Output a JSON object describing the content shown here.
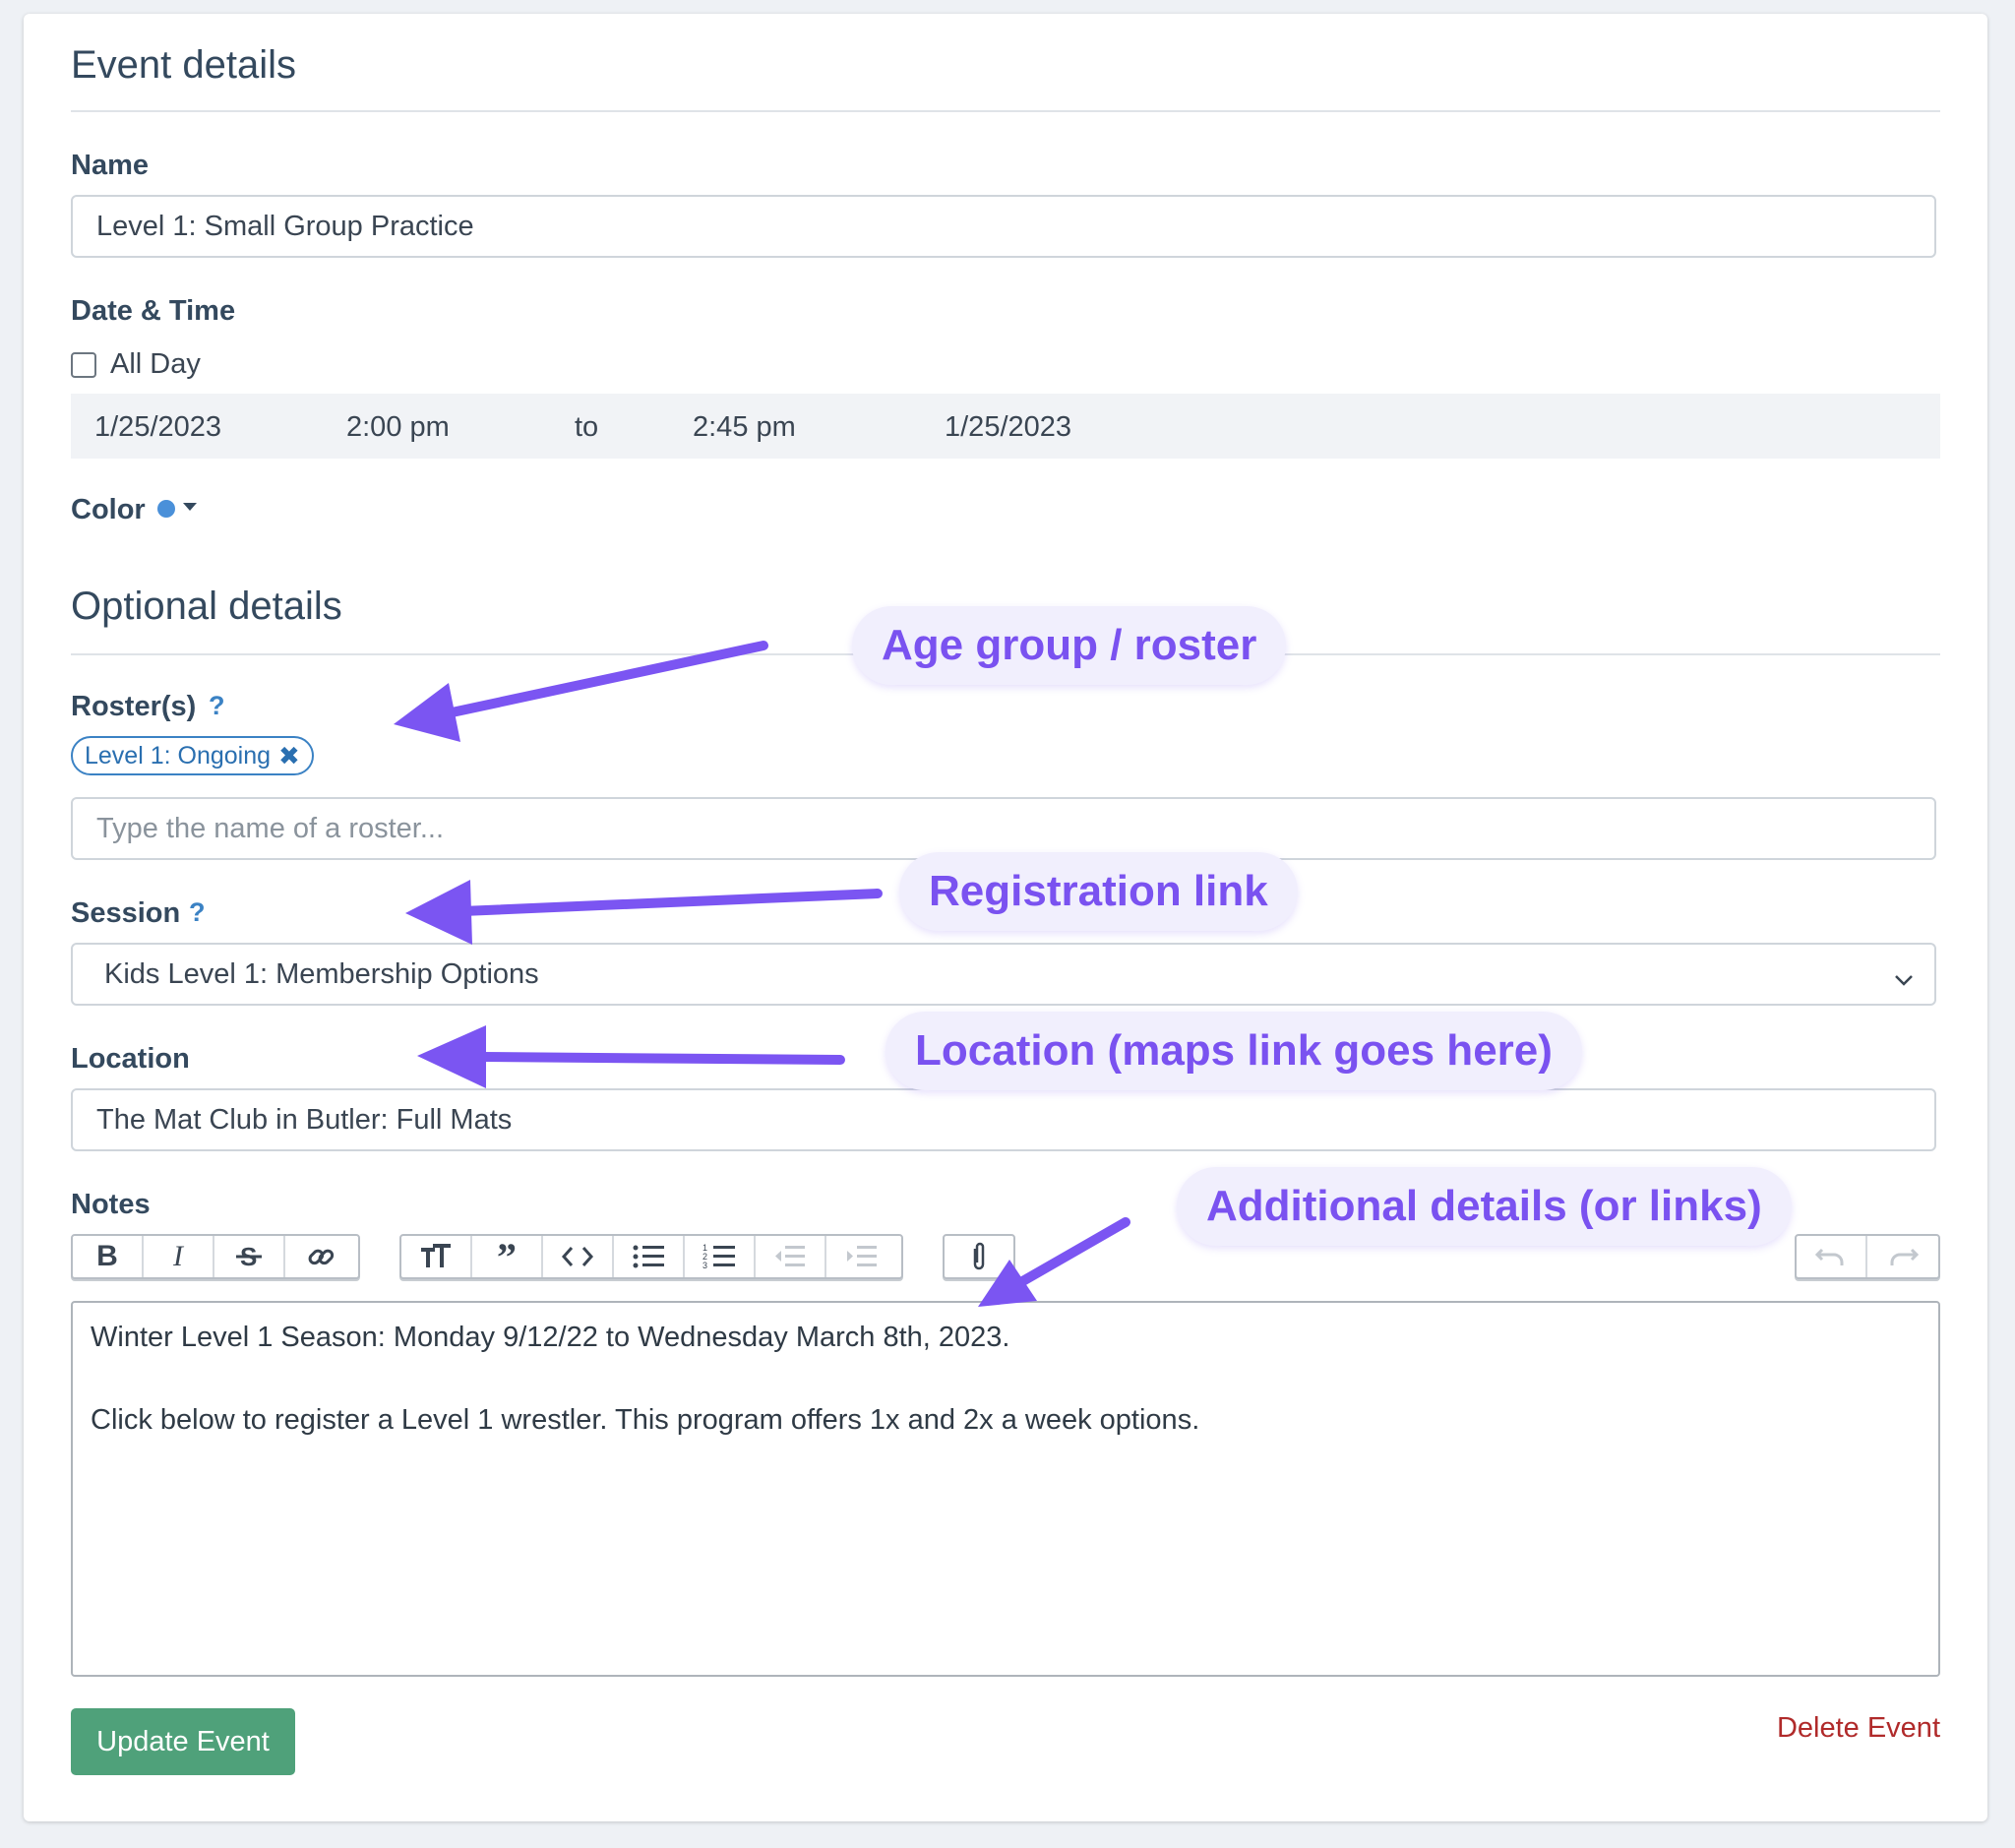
{
  "event_details": {
    "title": "Event details",
    "name_label": "Name",
    "name_value": "Level 1: Small Group Practice",
    "datetime_label": "Date & Time",
    "all_day_label": "All Day",
    "start_date": "1/25/2023",
    "start_time": "2:00 pm",
    "to_label": "to",
    "end_time": "2:45 pm",
    "end_date": "1/25/2023",
    "color_label": "Color",
    "color_value": "#4a90d9"
  },
  "optional_details": {
    "title": "Optional details",
    "rosters_label": "Roster(s)",
    "help_mark": "?",
    "roster_tag": "Level 1: Ongoing",
    "roster_placeholder": "Type the name of a roster...",
    "session_label": "Session",
    "session_value": "Kids Level 1: Membership Options",
    "location_label": "Location",
    "location_value": "The Mat Club in Butler: Full Mats",
    "notes_label": "Notes",
    "notes_lines": [
      "Winter Level 1 Season: Monday 9/12/22 to Wednesday March 8th, 2023.",
      "Click below to register a Level 1 wrestler. This program offers 1x and 2x a week options."
    ]
  },
  "toolbar": {
    "bold": "B",
    "italic": "I",
    "icons": [
      "bold-icon",
      "italic-icon",
      "strikethrough-icon",
      "link-icon",
      "heading-icon",
      "quote-icon",
      "code-icon",
      "bullet-list-icon",
      "numbered-list-icon",
      "outdent-icon",
      "indent-icon",
      "attach-icon",
      "undo-icon",
      "redo-icon"
    ]
  },
  "actions": {
    "update_label": "Update Event",
    "delete_label": "Delete Event"
  },
  "annotations": {
    "roster": "Age group / roster",
    "registration": "Registration link",
    "location": "Location (maps link goes here)",
    "additional": "Additional details (or links)",
    "accent": "#7b55f2"
  }
}
